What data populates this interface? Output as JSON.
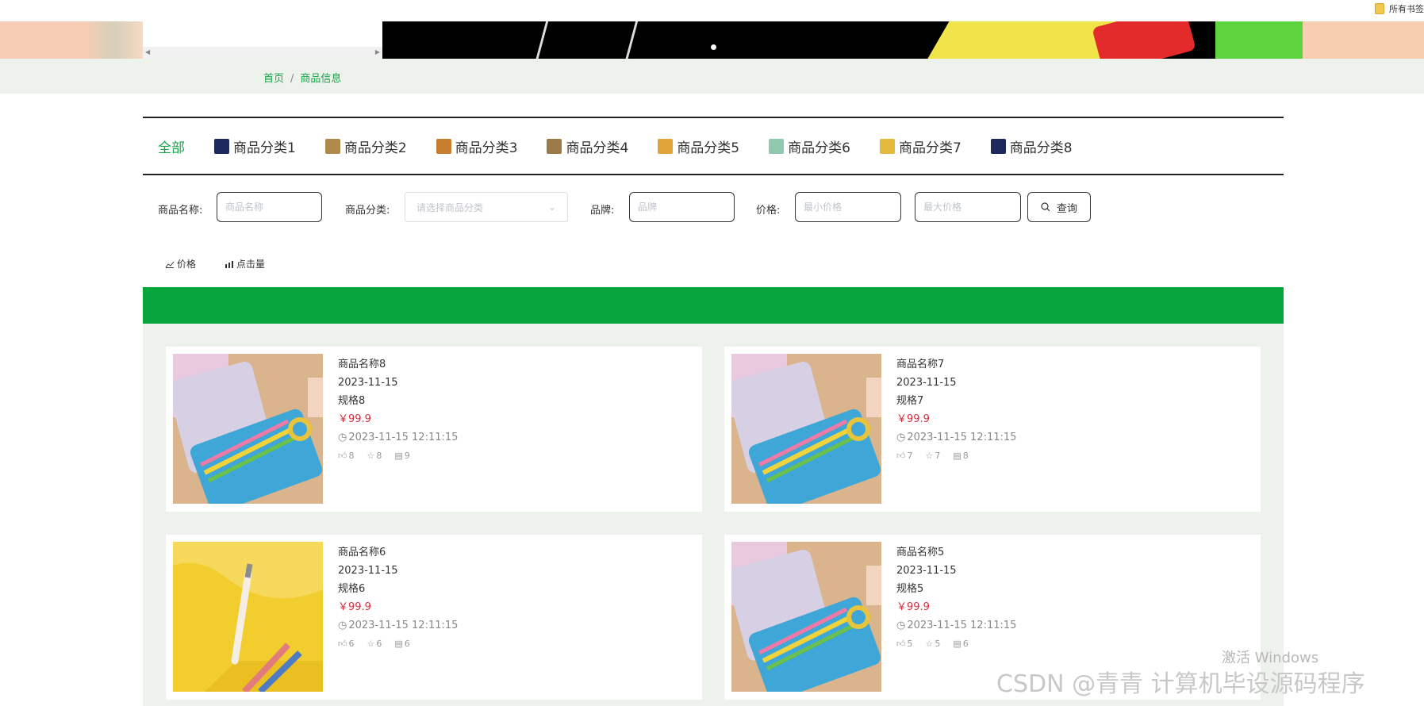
{
  "bookmarks": {
    "folder_label": "所有书签"
  },
  "breadcrumb": {
    "home": "首页",
    "separator": "/",
    "current": "商品信息"
  },
  "categories": [
    {
      "label": "全部",
      "active": true
    },
    {
      "label": "商品分类1",
      "thumb_color": "#1c2a5e"
    },
    {
      "label": "商品分类2",
      "thumb_color": "#b08a4a"
    },
    {
      "label": "商品分类3",
      "thumb_color": "#c97d2e"
    },
    {
      "label": "商品分类4",
      "thumb_color": "#9b7a48"
    },
    {
      "label": "商品分类5",
      "thumb_color": "#e0a43a"
    },
    {
      "label": "商品分类6",
      "thumb_color": "#8ec9b0"
    },
    {
      "label": "商品分类7",
      "thumb_color": "#e5b93d"
    },
    {
      "label": "商品分类8",
      "thumb_color": "#1c2a5e"
    }
  ],
  "filters": {
    "name_label": "商品名称:",
    "name_placeholder": "商品名称",
    "category_label": "商品分类:",
    "category_placeholder": "请选择商品分类",
    "brand_label": "品牌:",
    "brand_placeholder": "品牌",
    "price_label": "价格:",
    "min_price_placeholder": "最小价格",
    "max_price_placeholder": "最大价格",
    "search_button": "查询"
  },
  "sorts": {
    "price": "价格",
    "clicks": "点击量"
  },
  "products": [
    {
      "name": "商品名称8",
      "date": "2023-11-15",
      "spec": "规格8",
      "price": "￥99.9",
      "time": "2023-11-15 12:11:15",
      "likes": "8",
      "favorites": "8",
      "comments": "9",
      "image": "pencil-case"
    },
    {
      "name": "商品名称7",
      "date": "2023-11-15",
      "spec": "规格7",
      "price": "￥99.9",
      "time": "2023-11-15 12:11:15",
      "likes": "7",
      "favorites": "7",
      "comments": "8",
      "image": "pencil-case"
    },
    {
      "name": "商品名称6",
      "date": "2023-11-15",
      "spec": "规格6",
      "price": "￥99.9",
      "time": "2023-11-15 12:11:15",
      "likes": "6",
      "favorites": "6",
      "comments": "6",
      "image": "pens-yellow"
    },
    {
      "name": "商品名称5",
      "date": "2023-11-15",
      "spec": "规格5",
      "price": "￥99.9",
      "time": "2023-11-15 12:11:15",
      "likes": "5",
      "favorites": "5",
      "comments": "6",
      "image": "pencil-case"
    }
  ],
  "watermarks": {
    "windows": "激活 Windows",
    "csdn": "CSDN @青青  计算机毕设源码程序"
  },
  "colors": {
    "accent": "#07a63d",
    "price": "#e0263b",
    "breadcrumb": "#17a34a"
  }
}
